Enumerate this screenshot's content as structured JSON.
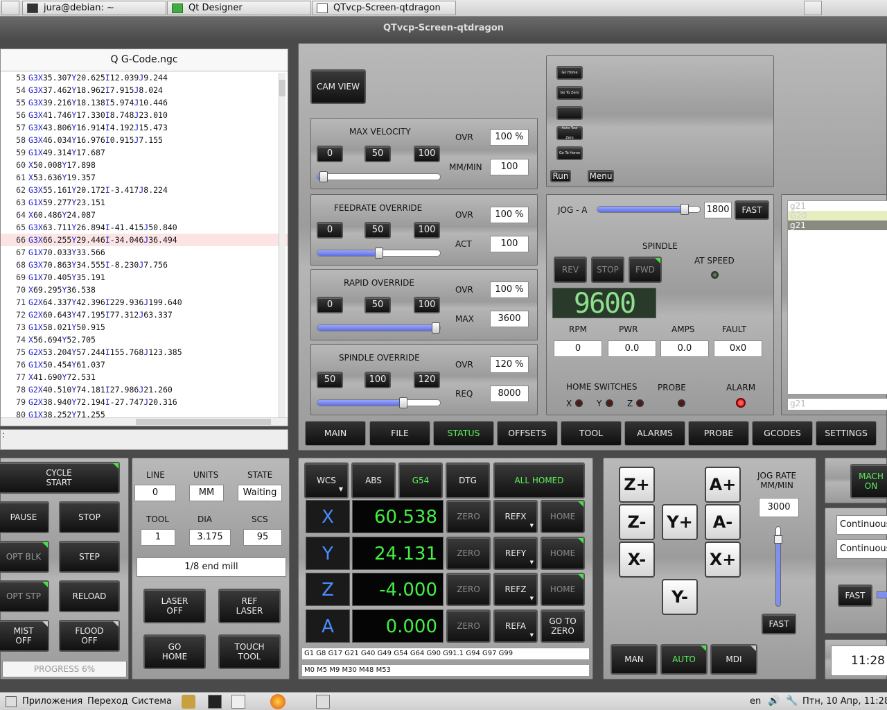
{
  "taskbar": {
    "tasks": [
      "jura@debian: ~",
      "Qt Designer",
      "QTvcp-Screen-qtdragon"
    ]
  },
  "window": {
    "title": "QTvcp-Screen-qtdragon"
  },
  "gcode": {
    "title": "Q G-Code.ngc",
    "lines": [
      [
        "53",
        "G3",
        "X35.307",
        "Y20.625",
        "I12.039",
        "J9.244"
      ],
      [
        "54",
        "G3",
        "X37.462",
        "Y18.962",
        "I7.915",
        "J8.024"
      ],
      [
        "55",
        "G3",
        "X39.216",
        "Y18.138",
        "I5.974",
        "J10.446"
      ],
      [
        "56",
        "G3",
        "X41.746",
        "Y17.330",
        "I8.748",
        "J23.010"
      ],
      [
        "57",
        "G3",
        "X43.806",
        "Y16.914",
        "I4.192",
        "J15.473"
      ],
      [
        "58",
        "G3",
        "X46.034",
        "Y16.976",
        "I0.915",
        "J7.155"
      ],
      [
        "59",
        "G1",
        "X49.314",
        "Y17.687",
        "",
        ""
      ],
      [
        "60",
        "",
        "X50.008",
        "Y17.898",
        "",
        ""
      ],
      [
        "61",
        "",
        "X53.636",
        "Y19.357",
        "",
        ""
      ],
      [
        "62",
        "G3",
        "X55.161",
        "Y20.172",
        "I-3.417",
        "J8.224"
      ],
      [
        "63",
        "G1",
        "X59.277",
        "Y23.151",
        "",
        ""
      ],
      [
        "64",
        "",
        "X60.486",
        "Y24.087",
        "",
        ""
      ],
      [
        "65",
        "G3",
        "X63.711",
        "Y26.894",
        "I-41.415",
        "J50.840"
      ],
      [
        "66",
        "G3",
        "X66.255",
        "Y29.446",
        "I-34.046",
        "J36.494"
      ],
      [
        "67",
        "G1",
        "X70.033",
        "Y33.566",
        "",
        ""
      ],
      [
        "68",
        "G3",
        "X70.863",
        "Y34.555",
        "I-8.230",
        "J7.756"
      ],
      [
        "69",
        "G1",
        "X70.405",
        "Y35.191",
        "",
        ""
      ],
      [
        "70",
        "",
        "X69.295",
        "Y36.538",
        "",
        ""
      ],
      [
        "71",
        "G2",
        "X64.337",
        "Y42.396",
        "I229.936",
        "J199.640"
      ],
      [
        "72",
        "G2",
        "X60.643",
        "Y47.195",
        "I77.312",
        "J63.337"
      ],
      [
        "73",
        "G1",
        "X58.021",
        "Y50.915",
        "",
        ""
      ],
      [
        "74",
        "",
        "X56.694",
        "Y52.705",
        "",
        ""
      ],
      [
        "75",
        "G2",
        "X53.204",
        "Y57.244",
        "I155.768",
        "J123.385"
      ],
      [
        "76",
        "G1",
        "X50.454",
        "Y61.037",
        "",
        ""
      ],
      [
        "77",
        "",
        "X41.690",
        "Y72.531",
        "",
        ""
      ],
      [
        "78",
        "G2",
        "X40.510",
        "Y74.181",
        "I27.986",
        "J21.260"
      ],
      [
        "79",
        "G2",
        "X38.940",
        "Y72.194",
        "I-27.747",
        "J20.316"
      ],
      [
        "80",
        "G1",
        "X38.252",
        "Y71.255",
        "",
        ""
      ]
    ],
    "highlight_line": "66",
    "mdi_prompt": ":"
  },
  "cam_view": "CAM VIEW",
  "macro": {
    "run": "Run",
    "menu": "Menu",
    "mini_labels": [
      "Go Home",
      "Go To Zero",
      "",
      "Auto Tool Zero",
      "Go To Home"
    ]
  },
  "max_velocity": {
    "title": "MAX VELOCITY",
    "b0": "0",
    "b1": "50",
    "b2": "100",
    "ovr_label": "OVR",
    "ovr": "100 %",
    "unit_label": "MM/MIN",
    "unit_val": "100",
    "slider": 0.05
  },
  "feed": {
    "title": "FEEDRATE OVERRIDE",
    "b0": "0",
    "b1": "50",
    "b2": "100",
    "ovr_label": "OVR",
    "ovr": "100 %",
    "act_label": "ACT",
    "act": "100",
    "slider": 0.5
  },
  "rapid": {
    "title": "RAPID OVERRIDE",
    "b0": "0",
    "b1": "50",
    "b2": "100",
    "ovr_label": "OVR",
    "ovr": "100 %",
    "max_label": "MAX",
    "max": "3600",
    "slider": 1.0
  },
  "spindle_ovr": {
    "title": "SPINDLE OVERRIDE",
    "b0": "50",
    "b1": "100",
    "b2": "120",
    "ovr_label": "OVR",
    "ovr": "120 %",
    "req_label": "REQ",
    "req": "8000",
    "slider": 0.7
  },
  "jog_a": {
    "label": "JOG - A",
    "value": "1800",
    "fast": "FAST",
    "slider": 0.85
  },
  "spindle": {
    "title": "SPINDLE",
    "rev": "REV",
    "stop": "STOP",
    "fwd": "FWD",
    "at_speed": "AT SPEED",
    "display": "9600",
    "rpm_label": "RPM",
    "pwr_label": "PWR",
    "amps_label": "AMPS",
    "fault_label": "FAULT",
    "rpm": "0",
    "pwr": "0.0",
    "amps": "0.0",
    "fault": "0x0"
  },
  "switches": {
    "home_label": "HOME SWITCHES",
    "probe_label": "PROBE",
    "alarm_label": "ALARM",
    "x": "X",
    "y": "Y",
    "z": "Z"
  },
  "gcode_list": {
    "items": [
      "g21",
      "G20",
      "g21"
    ],
    "input": "g21"
  },
  "tabs": [
    "MAIN",
    "FILE",
    "STATUS",
    "OFFSETS",
    "TOOL",
    "ALARMS",
    "PROBE",
    "GCODES",
    "SETTINGS"
  ],
  "active_tab": "STATUS",
  "left_controls": {
    "cycle_start": "CYCLE\nSTART",
    "pause": "PAUSE",
    "stop": "STOP",
    "opt_blk": "OPT BLK",
    "step": "STEP",
    "opt_stp": "OPT STP",
    "reload": "RELOAD",
    "mist": "MIST\nOFF",
    "flood": "FLOOD\nOFF",
    "progress": "PROGRESS 6%"
  },
  "info": {
    "line_label": "LINE",
    "units_label": "UNITS",
    "state_label": "STATE",
    "line": "0",
    "units": "MM",
    "state": "Waiting",
    "tool_label": "TOOL",
    "dia_label": "DIA",
    "scs_label": "SCS",
    "tool": "1",
    "dia": "3.175",
    "scs": "95",
    "tool_desc": "1/8 end mill",
    "laser_off": "LASER\nOFF",
    "ref_laser": "REF\nLASER",
    "go_home": "GO\nHOME",
    "touch_tool": "TOUCH\nTOOL"
  },
  "dro": {
    "wcs": "WCS",
    "abs": "ABS",
    "g54": "G54",
    "dtg": "DTG",
    "all_homed": "ALL HOMED",
    "axes": [
      {
        "name": "X",
        "value": "60.538",
        "zero": "ZERO",
        "ref": "REFX",
        "home": "HOME"
      },
      {
        "name": "Y",
        "value": "24.131",
        "zero": "ZERO",
        "ref": "REFY",
        "home": "HOME"
      },
      {
        "name": "Z",
        "value": "-4.000",
        "zero": "ZERO",
        "ref": "REFZ",
        "home": "HOME"
      },
      {
        "name": "A",
        "value": "0.000",
        "zero": "ZERO",
        "ref": "REFA",
        "home": "GO TO ZERO"
      }
    ],
    "gcodes": "G1 G8 G17 G21 G40 G49 G54 G64 G90 G91.1 G94 G97 G99",
    "mcodes": "M0 M5 M9 M30 M48 M53"
  },
  "jog": {
    "zp": "Z+",
    "zm": "Z-",
    "yp": "Y+",
    "ym": "Y-",
    "xp": "X+",
    "xm": "X-",
    "ap": "A+",
    "am": "A-",
    "rate_label": "JOG RATE\nMM/MIN",
    "rate": "3000",
    "fast": "FAST",
    "man": "MAN",
    "auto": "AUTO",
    "mdi": "MDI"
  },
  "right": {
    "mach": "MACH\nON",
    "cont1": "Continuous",
    "cont2": "Continuous",
    "fast": "FAST",
    "time": "11:28"
  },
  "bottombar": {
    "apps": "Приложения",
    "go": "Переход",
    "system": "Система",
    "lang": "en",
    "datetime": "Птн, 10 Апр, 11:28"
  }
}
